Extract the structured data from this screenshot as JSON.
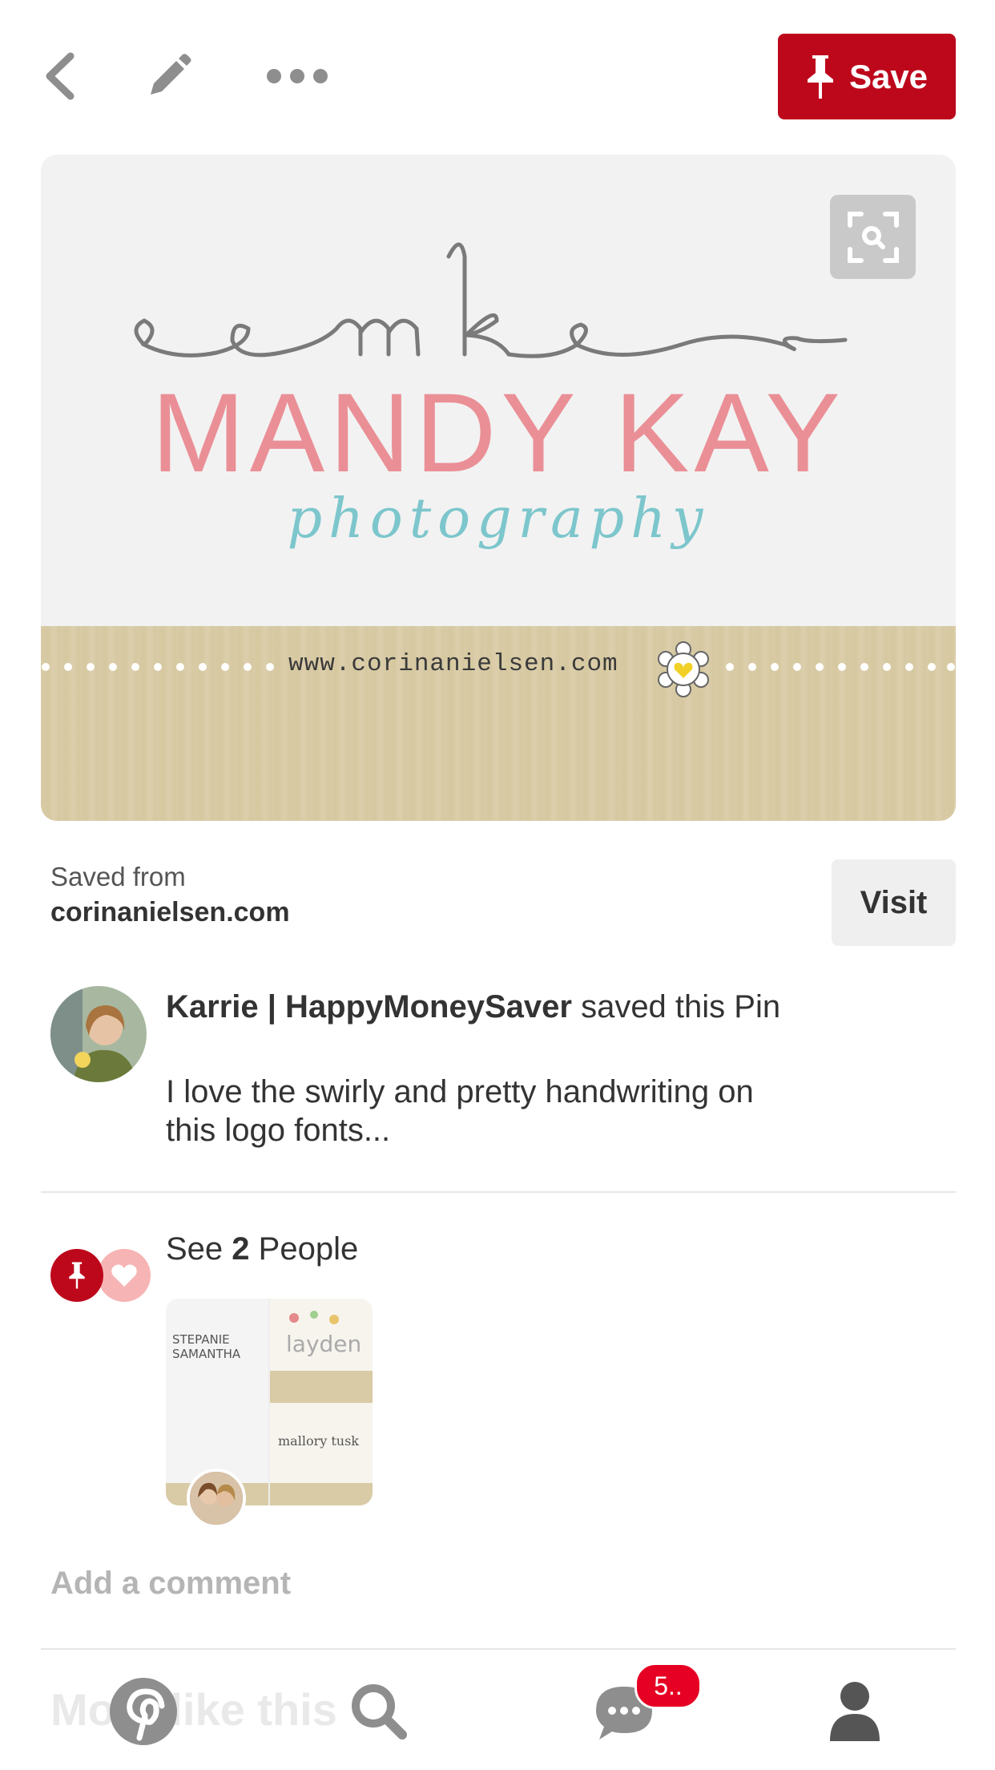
{
  "toolbar": {
    "back_icon": "chevron-left-icon",
    "edit_icon": "pencil-icon",
    "more_icon": "ellipsis-icon",
    "save_label": "Save",
    "save_color": "#bd081c"
  },
  "pin": {
    "zoom_icon": "visual-search-icon",
    "logo_monogram": "mk",
    "logo_name": "MANDY KAY",
    "logo_tagline": "photography",
    "logo_url": "www.corinanielsen.com"
  },
  "source": {
    "saved_from_label": "Saved from",
    "domain": "corinanielsen.com",
    "visit_label": "Visit"
  },
  "saver": {
    "name": "Karrie | HappyMoneySaver",
    "action": " saved this Pin",
    "description": "I love the swirly and pretty handwriting on this logo fonts..."
  },
  "activity": {
    "see_prefix": "See ",
    "count": "2",
    "see_suffix": " People",
    "board_names": [
      "STEPANIE",
      "SAMANTHA",
      "layden",
      "mallory tusk"
    ]
  },
  "comment": {
    "placeholder": "Add a comment"
  },
  "more_like_this": "More like this",
  "nav": {
    "home_icon": "pinterest-logo-icon",
    "search_icon": "search-icon",
    "messages_icon": "chat-bubble-icon",
    "messages_badge": "5..",
    "profile_icon": "person-icon"
  }
}
